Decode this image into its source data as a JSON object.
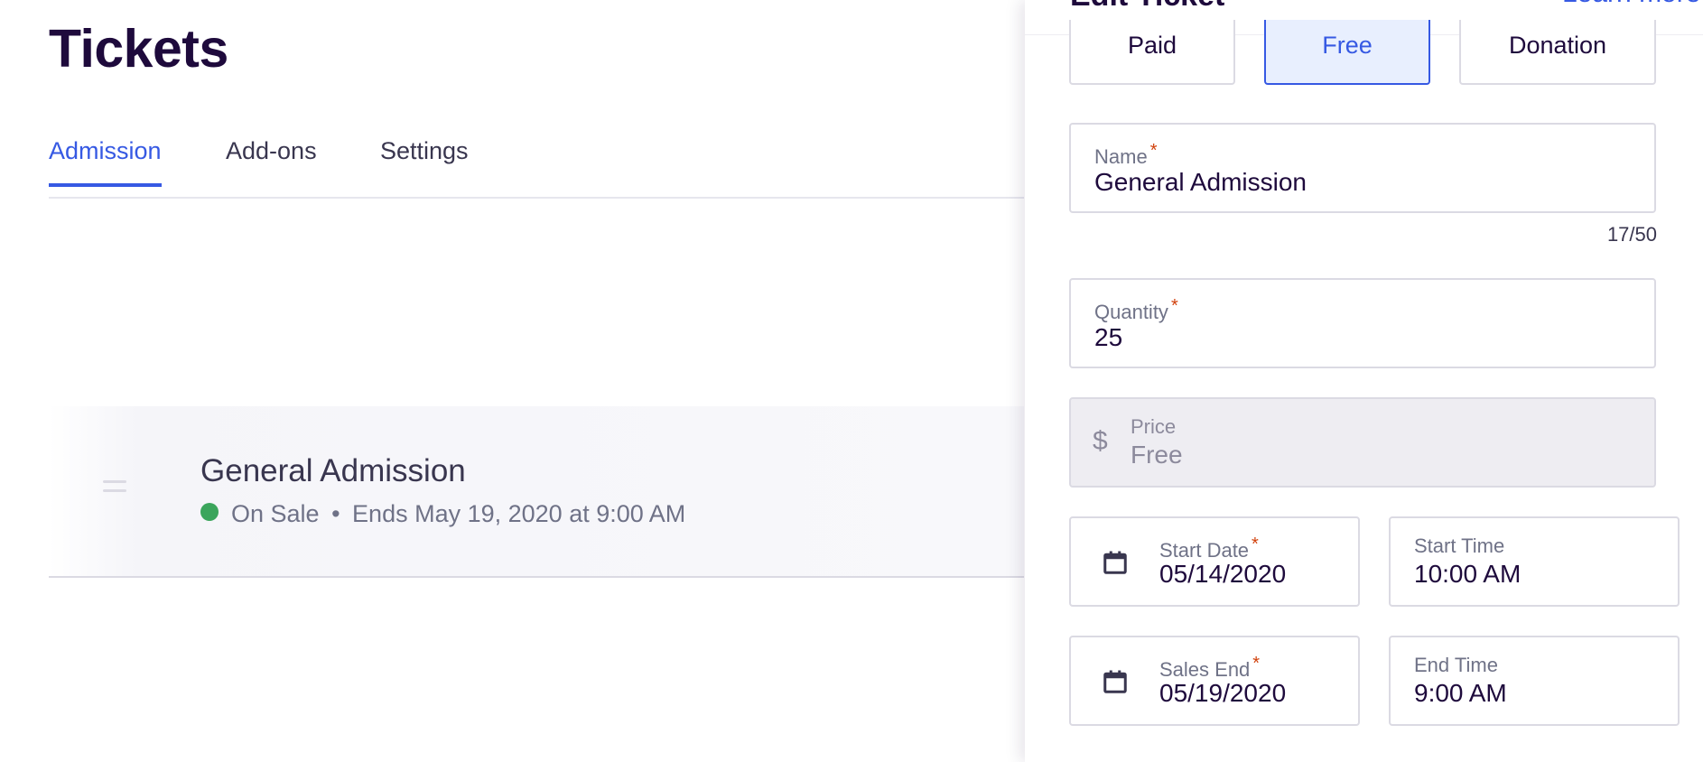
{
  "page": {
    "title": "Tickets",
    "tabs": [
      {
        "label": "Admission",
        "active": true
      },
      {
        "label": "Add-ons",
        "active": false
      },
      {
        "label": "Settings",
        "active": false
      }
    ]
  },
  "ticket": {
    "name": "General Admission",
    "status": "On Sale",
    "separator": "•",
    "ends": "Ends May 19, 2020 at 9:00 AM",
    "status_color": "#3ba55c"
  },
  "drawer": {
    "title": "Edit Ticket",
    "learn_more": "Learn more",
    "types": [
      {
        "label": "Paid",
        "selected": false
      },
      {
        "label": "Free",
        "selected": true
      },
      {
        "label": "Donation",
        "selected": false
      }
    ],
    "name": {
      "label": "Name",
      "required": "*",
      "value": "General Admission",
      "count": "17/50"
    },
    "quantity": {
      "label": "Quantity",
      "required": "*",
      "value": "25"
    },
    "price": {
      "currency": "$",
      "label": "Price",
      "value": "Free"
    },
    "start_date": {
      "label": "Start Date",
      "required": "*",
      "value": "05/14/2020",
      "icon": "calendar-icon"
    },
    "start_time": {
      "label": "Start Time",
      "value": "10:00 AM"
    },
    "sales_end": {
      "label": "Sales End",
      "required": "*",
      "value": "05/19/2020",
      "icon": "calendar-icon"
    },
    "end_time": {
      "label": "End Time",
      "value": "9:00 AM"
    }
  },
  "colors": {
    "accent": "#3659e3",
    "heading": "#1e0a3c",
    "required": "#d1410c",
    "selected_bg": "#e8effe"
  }
}
